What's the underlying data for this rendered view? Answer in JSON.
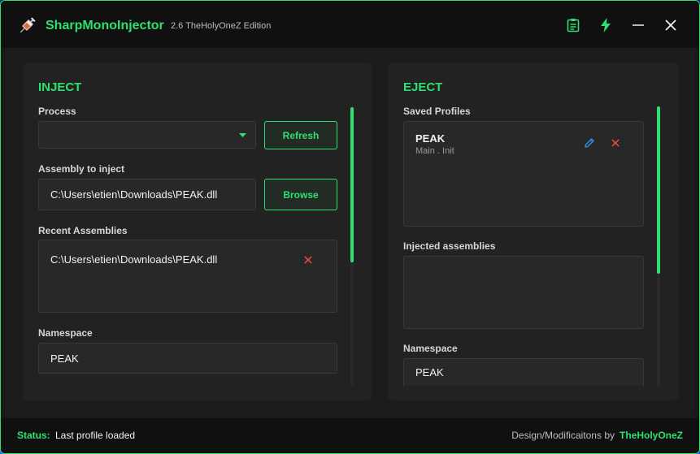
{
  "app": {
    "title": "SharpMonoInjector",
    "version": "2.6 TheHolyOneZ Edition"
  },
  "colors": {
    "accent": "#2ee070",
    "danger": "#e04848",
    "edit": "#2f8ee0"
  },
  "titlebar_buttons": [
    "clipboard-icon",
    "lightning-icon",
    "minimize-icon",
    "close-icon"
  ],
  "inject": {
    "title": "INJECT",
    "process_label": "Process",
    "process_value": "",
    "refresh_label": "Refresh",
    "assembly_label": "Assembly to inject",
    "assembly_value": "C:\\Users\\etien\\Downloads\\PEAK.dll",
    "browse_label": "Browse",
    "recent_label": "Recent Assemblies",
    "recent_items": [
      "C:\\Users\\etien\\Downloads\\PEAK.dll"
    ],
    "namespace_label": "Namespace",
    "namespace_value": "PEAK"
  },
  "eject": {
    "title": "EJECT",
    "saved_label": "Saved Profiles",
    "profiles": [
      {
        "name": "PEAK",
        "detail": "Main . Init"
      }
    ],
    "injected_label": "Injected assemblies",
    "namespace_label": "Namespace",
    "namespace_value": "PEAK"
  },
  "status": {
    "key": "Status:",
    "value": "Last profile loaded",
    "credit_key": "Design/Modificaitons by",
    "credit_value": "TheHolyOneZ"
  }
}
